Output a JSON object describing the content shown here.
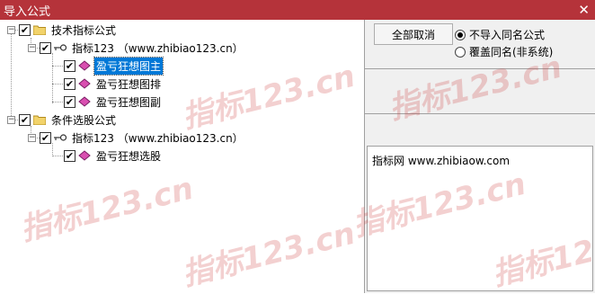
{
  "window": {
    "title": "导入公式",
    "close_label": "✕"
  },
  "tree": {
    "items": [
      {
        "label": "技术指标公式",
        "icon": "folder-icon"
      },
      {
        "label": "指标123 （www.zhibiao123.cn）",
        "icon": "key-icon"
      },
      {
        "label": "盈亏狂想图主",
        "icon": "formula-icon"
      },
      {
        "label": "盈亏狂想图排",
        "icon": "formula-icon"
      },
      {
        "label": "盈亏狂想图副",
        "icon": "formula-icon"
      },
      {
        "label": "条件选股公式",
        "icon": "folder-icon"
      },
      {
        "label": "指标123 （www.zhibiao123.cn）",
        "icon": "key-icon"
      },
      {
        "label": "盈亏狂想选股",
        "icon": "formula-icon"
      }
    ]
  },
  "options": {
    "cancel_all_label": "全部取消",
    "no_import_label": "不导入同名公式",
    "overwrite_label": "覆盖同名(非系统)"
  },
  "description": {
    "text": "指标网 www.zhibiaow.com"
  },
  "watermark": {
    "text": "指标123.cn"
  },
  "colors": {
    "titlebar": "#b5333a",
    "selection": "#0078d7"
  }
}
